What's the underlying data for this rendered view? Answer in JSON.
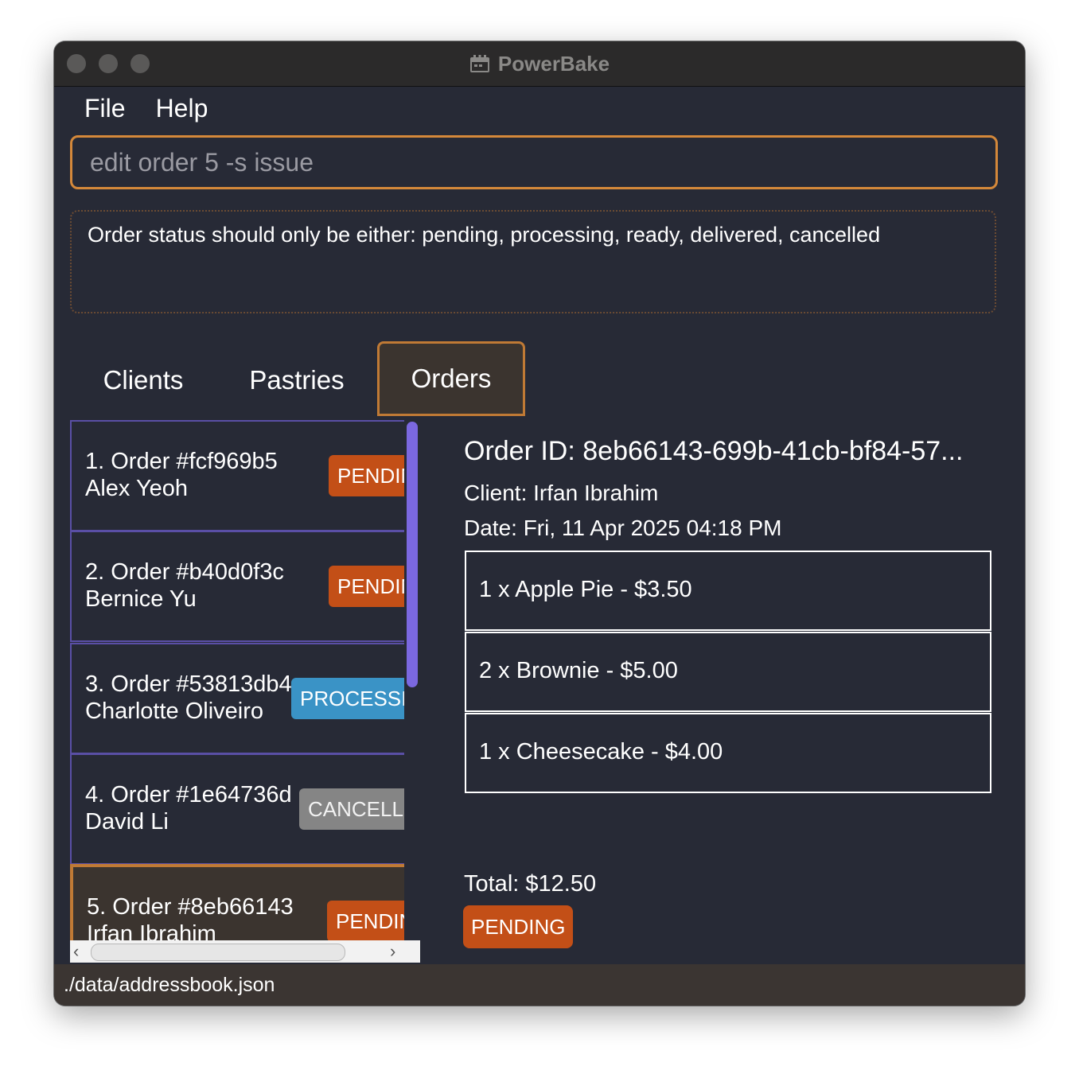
{
  "window": {
    "title": "PowerBake"
  },
  "menu": {
    "file": "File",
    "help": "Help"
  },
  "command": {
    "value": "edit order 5 -s issue"
  },
  "result": {
    "message": "Order status should only be either: pending, processing, ready, delivered, cancelled"
  },
  "tabs": {
    "clients": "Clients",
    "pastries": "Pastries",
    "orders": "Orders",
    "active": "Orders"
  },
  "orders": [
    {
      "title": "1. Order #fcf969b5",
      "client": "Alex Yeoh",
      "status": "PENDING"
    },
    {
      "title": "2. Order #b40d0f3c",
      "client": "Bernice Yu",
      "status": "PENDING"
    },
    {
      "title": "3. Order #53813db4",
      "client": "Charlotte Oliveiro",
      "status": "PROCESSING"
    },
    {
      "title": "4. Order #1e64736d",
      "client": "David Li",
      "status": "CANCELLED"
    },
    {
      "title": "5. Order #8eb66143",
      "client": "Irfan Ibrahim",
      "status": "PENDING"
    }
  ],
  "detail": {
    "order_id": "Order ID: 8eb66143-699b-41cb-bf84-57...",
    "client": "Client: Irfan Ibrahim",
    "date": "Date: Fri, 11 Apr 2025 04:18 PM",
    "items": [
      "1 x Apple Pie - $3.50",
      "2 x Brownie - $5.00",
      "1 x Cheesecake - $4.00"
    ],
    "total": "Total: $12.50",
    "status": "PENDING"
  },
  "statusbar": {
    "path": "./data/addressbook.json"
  },
  "colors": {
    "background": "#272a36",
    "accent": "#d4883a",
    "pending": "#c34f17",
    "processing": "#3a93c6",
    "cancelled": "#858585",
    "list_border": "#5a4fa6",
    "scrollbar": "#7b68e0"
  }
}
